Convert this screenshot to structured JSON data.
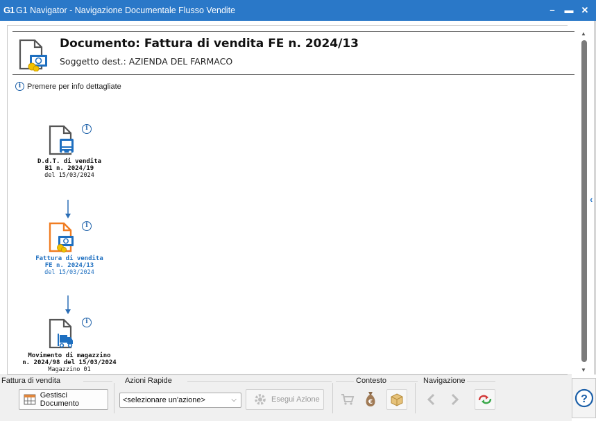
{
  "window": {
    "logo": "G1",
    "title": "G1 Navigator - Navigazione Documentale Flusso Vendite",
    "minimize": "–",
    "maximize": "▬",
    "close": "✕"
  },
  "document": {
    "title": "Documento: Fattura di vendita FE n. 2024/13",
    "subtitle": "Soggetto dest.: AZIENDA DEL FARMACO"
  },
  "info_hint": "Premere per info dettagliate",
  "flow": [
    {
      "icon": "ddt-truck-icon",
      "line1": "D.d.T. di vendita",
      "line2": "B1 n. 2024/19",
      "line3": "del 15/03/2024",
      "active": false
    },
    {
      "icon": "invoice-icon",
      "line1": "Fattura di vendita",
      "line2": "FE n. 2024/13",
      "line3": "del 15/03/2024",
      "active": true,
      "accent": "#f07d22"
    },
    {
      "icon": "warehouse-forklift-icon",
      "line1": "Movimento di magazzino",
      "line2": "n. 2024/98 del 15/03/2024",
      "line3": "Magazzino 01",
      "active": false
    }
  ],
  "toolbar": {
    "group_document": "Fattura di vendita",
    "manage_button": "Gestisci Documento",
    "group_quick": "Azioni Rapide",
    "select_value": "<selezionare un'azione>",
    "run_button": "Esegui Azione",
    "group_context": "Contesto",
    "group_navigation": "Navigazione",
    "icons": [
      "cart-icon",
      "money-bag-icon",
      "box-icon",
      "back-icon",
      "forward-icon",
      "refresh-icon",
      "help-icon"
    ]
  },
  "colors": {
    "titlebar": "#2a78c8",
    "active_text": "#1e6fc0",
    "active_icon": "#f07d22",
    "info": "#1b5fa8"
  }
}
